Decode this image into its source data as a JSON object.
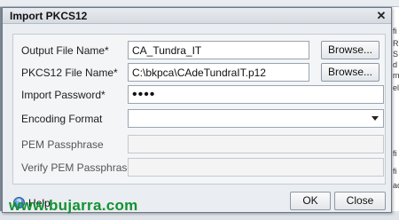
{
  "dialog": {
    "title": "Import PKCS12",
    "close_glyph": "✕"
  },
  "form": {
    "output_file": {
      "label": "Output File Name*",
      "value": "CA_Tundra_IT",
      "browse_label": "Browse..."
    },
    "pkcs12_file": {
      "label": "PKCS12 File Name*",
      "value": "C:\\bkpca\\CAdeTundraIT.p12",
      "browse_label": "Browse..."
    },
    "import_password": {
      "label": "Import Password*",
      "value": "••••"
    },
    "encoding_format": {
      "label": "Encoding Format",
      "value": ""
    },
    "pem_passphrase": {
      "label": "PEM Passphrase",
      "value": ""
    },
    "verify_pem_passphrase": {
      "label": "Verify PEM Passphrase",
      "value": ""
    }
  },
  "footer": {
    "help_label": "Help",
    "ok_label": "OK",
    "close_label": "Close"
  },
  "background": {
    "right_fragments": [
      "fi",
      "R",
      "S",
      "d",
      "m",
      "el",
      "fi",
      "fi",
      "ac"
    ]
  },
  "watermark": "www.bujarra.com",
  "icons": {
    "close": "close-icon",
    "help": "help-icon",
    "dropdown": "chevron-down-icon"
  }
}
